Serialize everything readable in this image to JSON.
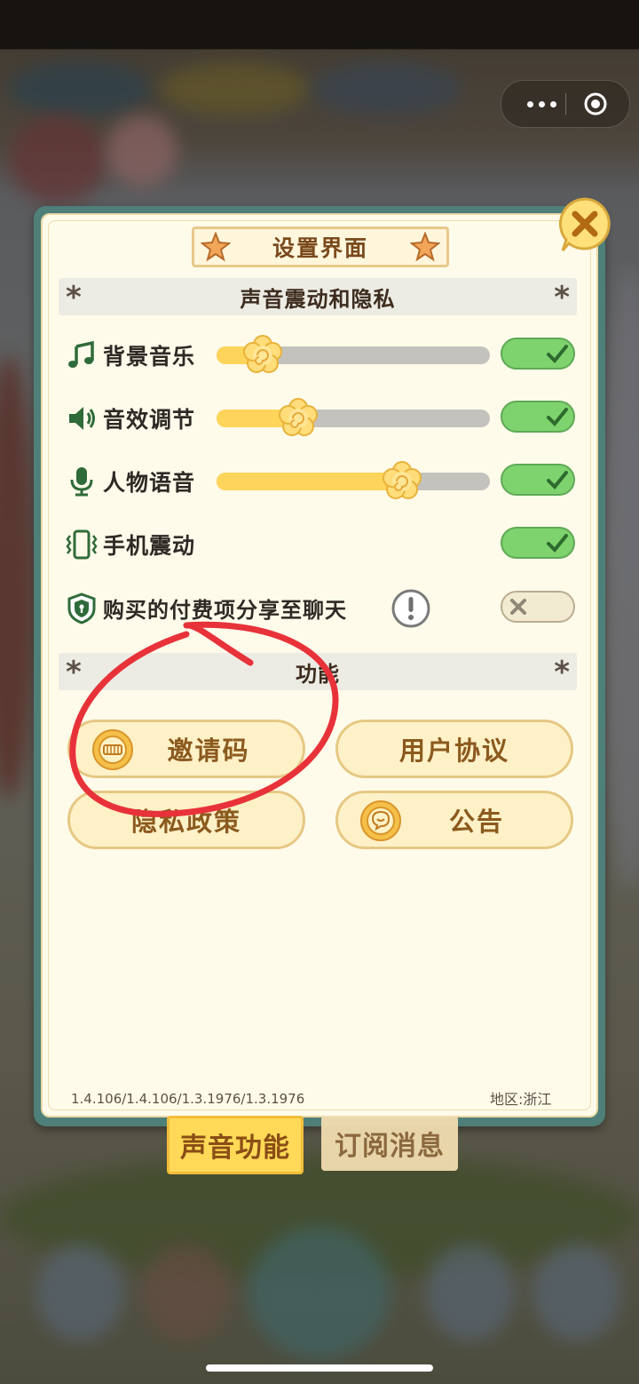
{
  "dialog": {
    "title": "设置界面",
    "sections": {
      "sound": "声音震动和隐私",
      "functions": "功能"
    },
    "section_marker": "*",
    "settings": [
      {
        "label": "背景音乐",
        "icon": "music-note-icon",
        "slider": 0.17,
        "enabled": true
      },
      {
        "label": "音效调节",
        "icon": "speaker-icon",
        "slider": 0.3,
        "enabled": true
      },
      {
        "label": "人物语音",
        "icon": "microphone-icon",
        "slider": 0.68,
        "enabled": true
      },
      {
        "label": "手机震动",
        "icon": "phone-vibrate-icon",
        "enabled": true
      },
      {
        "label": "购买的付费项分享至聊天",
        "icon": "shield-icon",
        "enabled": false
      }
    ],
    "buttons": {
      "invite": "邀请码",
      "agreement": "用户协议",
      "privacy": "隐私政策",
      "notice": "公告"
    },
    "version": "1.4.106/1.4.106/1.3.1976/1.3.1976",
    "region": "地区:浙江"
  },
  "tabs": {
    "sound": "声音功能",
    "subscribe": "订阅消息"
  },
  "colors": {
    "panel_border": "#4f7f79",
    "panel_bg": "#fffbea",
    "toggle_on": "#7fd36e",
    "slider_fill": "#ffd45a",
    "button_text": "#8b5a1e",
    "annotation": "#e8323a"
  }
}
